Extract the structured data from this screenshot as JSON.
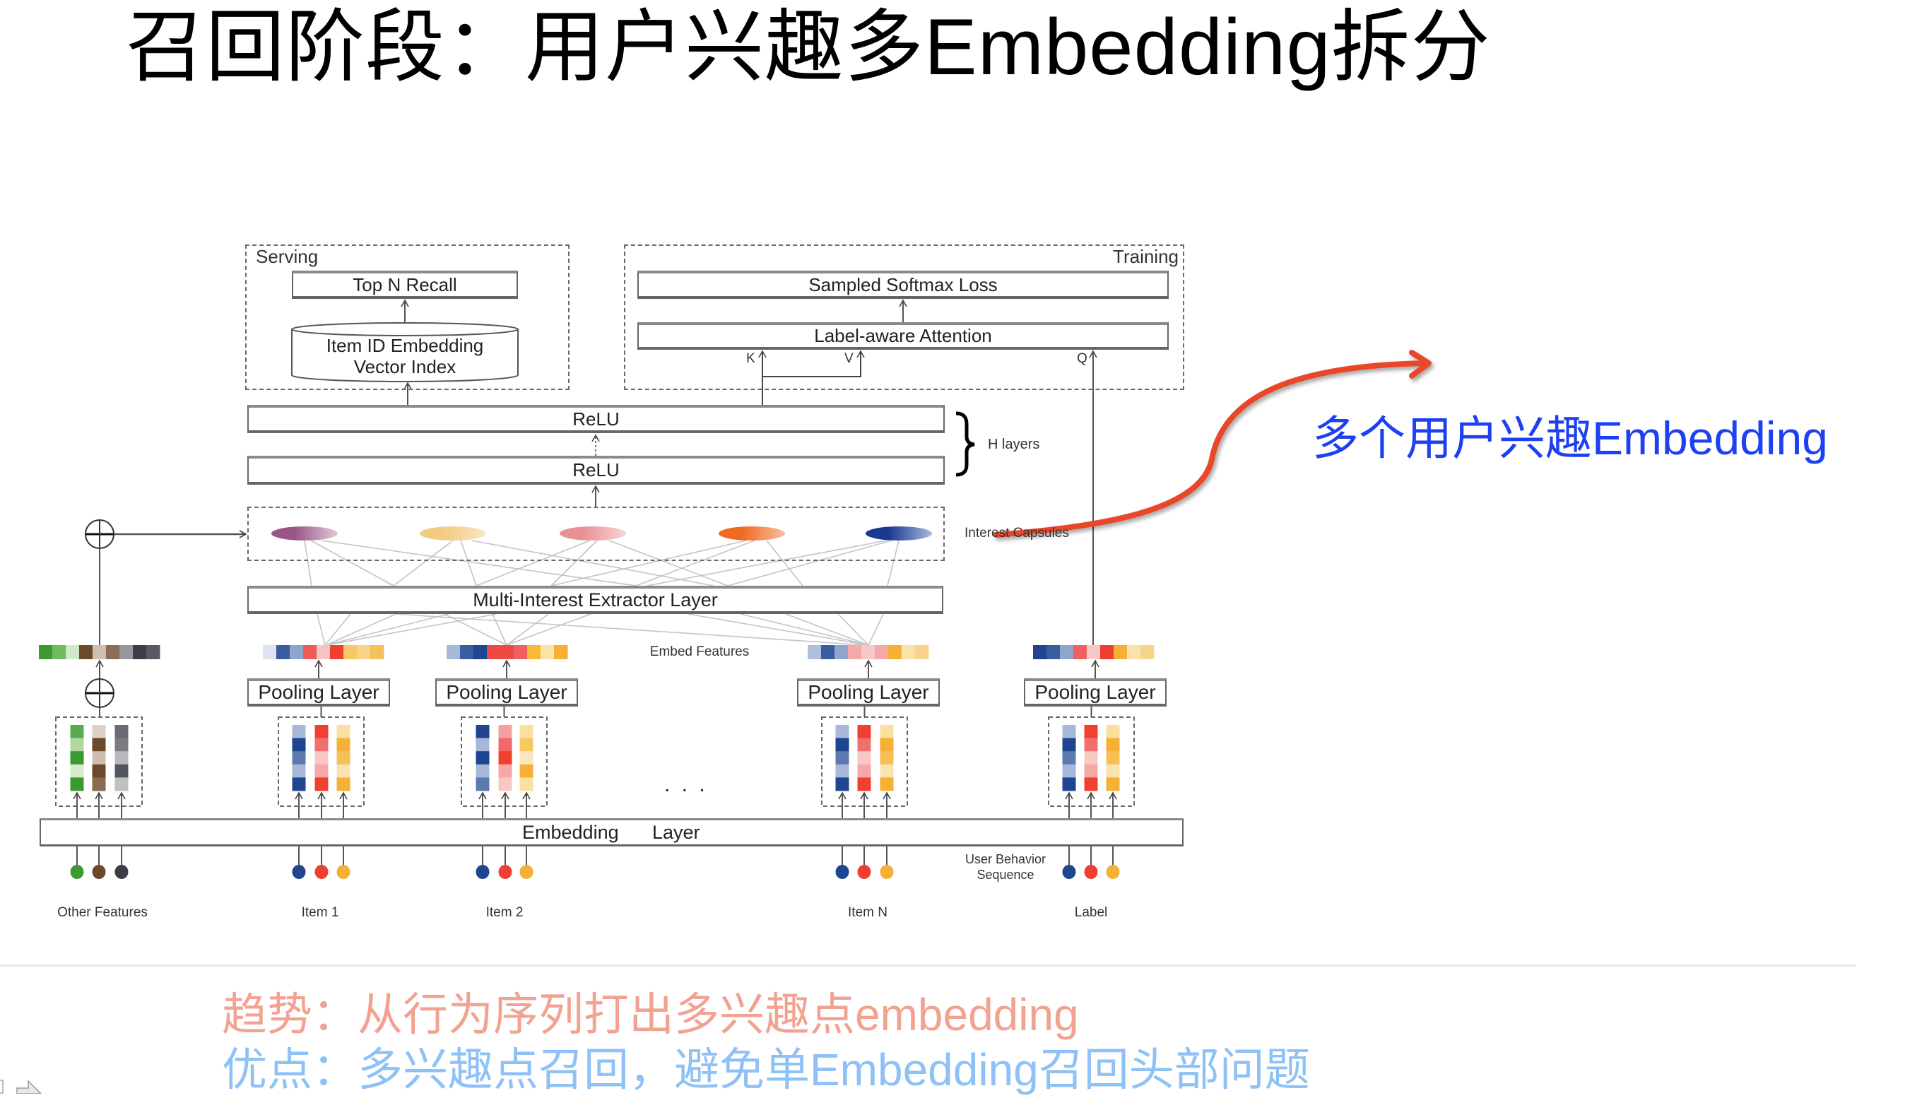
{
  "slide": {
    "title": "召回阶段：用户兴趣多Embedding拆分",
    "annotation": "多个用户兴趣Embedding",
    "notes": {
      "trend": "趋势：从行为序列打出多兴趣点embedding",
      "advantage": "优点：多兴趣点召回，避免单Embedding召回头部问题"
    },
    "colors": {
      "title": "#000000",
      "annotation": "#1d41f2",
      "highlight_arrow": "#e8462a",
      "trend": "#f2a291",
      "advantage": "#8ec1f5"
    }
  },
  "diagram": {
    "serving": {
      "label": "Serving",
      "top_n_recall": "Top N Recall",
      "index_line1": "Item ID Embedding",
      "index_line2": "Vector Index"
    },
    "training": {
      "label": "Training",
      "loss": "Sampled Softmax Loss",
      "attention": "Label-aware Attention",
      "k": "K",
      "v": "V",
      "q": "Q"
    },
    "relu_top": "ReLU",
    "relu_bottom": "ReLU",
    "h_layers": "H layers",
    "interest_capsules": "Interest Capsules",
    "capsules": [
      {
        "from": "#9a5585",
        "to": "#e2cbd9"
      },
      {
        "from": "#f2cc80",
        "to": "#f7e6c8"
      },
      {
        "from": "#e89095",
        "to": "#f5d4d6"
      },
      {
        "from": "#ef6a20",
        "to": "#f8c0a0"
      },
      {
        "from": "#1a3a90",
        "to": "#a8b8e0"
      }
    ],
    "extractor": "Multi-Interest Extractor Layer",
    "embed_features": "Embed Features",
    "pooling_layer": "Pooling Layer",
    "embedding_layer_word1": "Embedding",
    "embedding_layer_word2": "Layer",
    "ellipsis": ". . .",
    "user_behavior_line1": "User Behavior",
    "user_behavior_line2": "Sequence",
    "groups": [
      {
        "label": "Other Features",
        "combine": "oplus",
        "matrix": [
          [
            "#5aab50",
            "#b0d8a0",
            "#3a9a30",
            "#d4ebcc",
            "#3a9a30"
          ],
          [
            "#dcd2c8",
            "#6b4a2a",
            "#ccbfb0",
            "#6b4a2a",
            "#8b6a50"
          ],
          [
            "#6a6a72",
            "#7a7a82",
            "#b8b8bc",
            "#505560",
            "#c0c0c4"
          ]
        ],
        "dots": [
          "#3d9a30",
          "#6b4a28",
          "#3d3d4a"
        ],
        "feature_bar": [
          "#3d9a30",
          "#6fbb60",
          "#cfe8c8",
          "#6b4a28",
          "#cdbfb2",
          "#8b6e55",
          "#98989c",
          "#3d3d4a",
          "#5a5b62"
        ]
      },
      {
        "label": "Item 1",
        "combine": "pooling",
        "matrix": [
          [
            "#a8b8d8",
            "#1f4590",
            "#5a7ab0",
            "#a8b8d8",
            "#1f4590"
          ],
          [
            "#f04030",
            "#f07070",
            "#f8c8c4",
            "#f4a8a8",
            "#f04030"
          ],
          [
            "#fae0a0",
            "#f5b035",
            "#f5c055",
            "#fbe3b0",
            "#f5b035"
          ]
        ],
        "dots": [
          "#1f4590",
          "#ee4030",
          "#f5b035"
        ],
        "feature_bar": [
          "#dde3f1",
          "#3a5da0",
          "#8fa5cc",
          "#ee5a55",
          "#f6c3c2",
          "#ee4030",
          "#f8c868",
          "#f8d48a",
          "#f6c05a"
        ]
      },
      {
        "label": "Item 2",
        "combine": "pooling",
        "matrix": [
          [
            "#1f4590",
            "#a8b8d8",
            "#1f4590",
            "#a8b8d8",
            "#5a7ab0"
          ],
          [
            "#f4a0a0",
            "#f06a6a",
            "#f04030",
            "#f4a8a8",
            "#f8c8c4"
          ],
          [
            "#fae0a0",
            "#f8c860",
            "#fbe6c0",
            "#f5b035",
            "#fbe0a0"
          ]
        ],
        "dots": [
          "#1f4590",
          "#ee4030",
          "#f5b035"
        ],
        "feature_bar": [
          "#a8b8d8",
          "#3a5da0",
          "#1f4590",
          "#ee4a45",
          "#ee4a45",
          "#ef6060",
          "#f8b838",
          "#fbe2a8",
          "#f5b035"
        ]
      },
      {
        "label": "Item N",
        "combine": "pooling",
        "matrix": [
          [
            "#a8b8d8",
            "#1f4590",
            "#5a7ab0",
            "#a8b8d8",
            "#1f4590"
          ],
          [
            "#f04030",
            "#f07070",
            "#f8c8c4",
            "#f4a8a8",
            "#f04030"
          ],
          [
            "#fae0a0",
            "#f5b035",
            "#f5c055",
            "#fbe3b0",
            "#f5b035"
          ]
        ],
        "dots": [
          "#1f4590",
          "#ee4030",
          "#f5b035"
        ],
        "feature_bar": [
          "#b0c0dc",
          "#3a5da0",
          "#8fa5cc",
          "#f4a8a8",
          "#f8c8c8",
          "#f4a8a8",
          "#f5b035",
          "#fbe2a8",
          "#f8d48a"
        ]
      },
      {
        "label": "Label",
        "combine": "pooling",
        "matrix": [
          [
            "#a8b8d8",
            "#1f4590",
            "#5a7ab0",
            "#a8b8d8",
            "#1f4590"
          ],
          [
            "#f04030",
            "#f07070",
            "#f8c8c4",
            "#f4a8a8",
            "#f04030"
          ],
          [
            "#fae0a0",
            "#f5b035",
            "#f5c055",
            "#fbe3b0",
            "#f5b035"
          ]
        ],
        "dots": [
          "#1f4590",
          "#ee4030",
          "#f5b035"
        ],
        "feature_bar": [
          "#1f4590",
          "#3a5da0",
          "#8fa5cc",
          "#ef6060",
          "#f8c8c8",
          "#ee4030",
          "#f5b035",
          "#fbe2a8",
          "#f8d48a"
        ]
      }
    ]
  }
}
